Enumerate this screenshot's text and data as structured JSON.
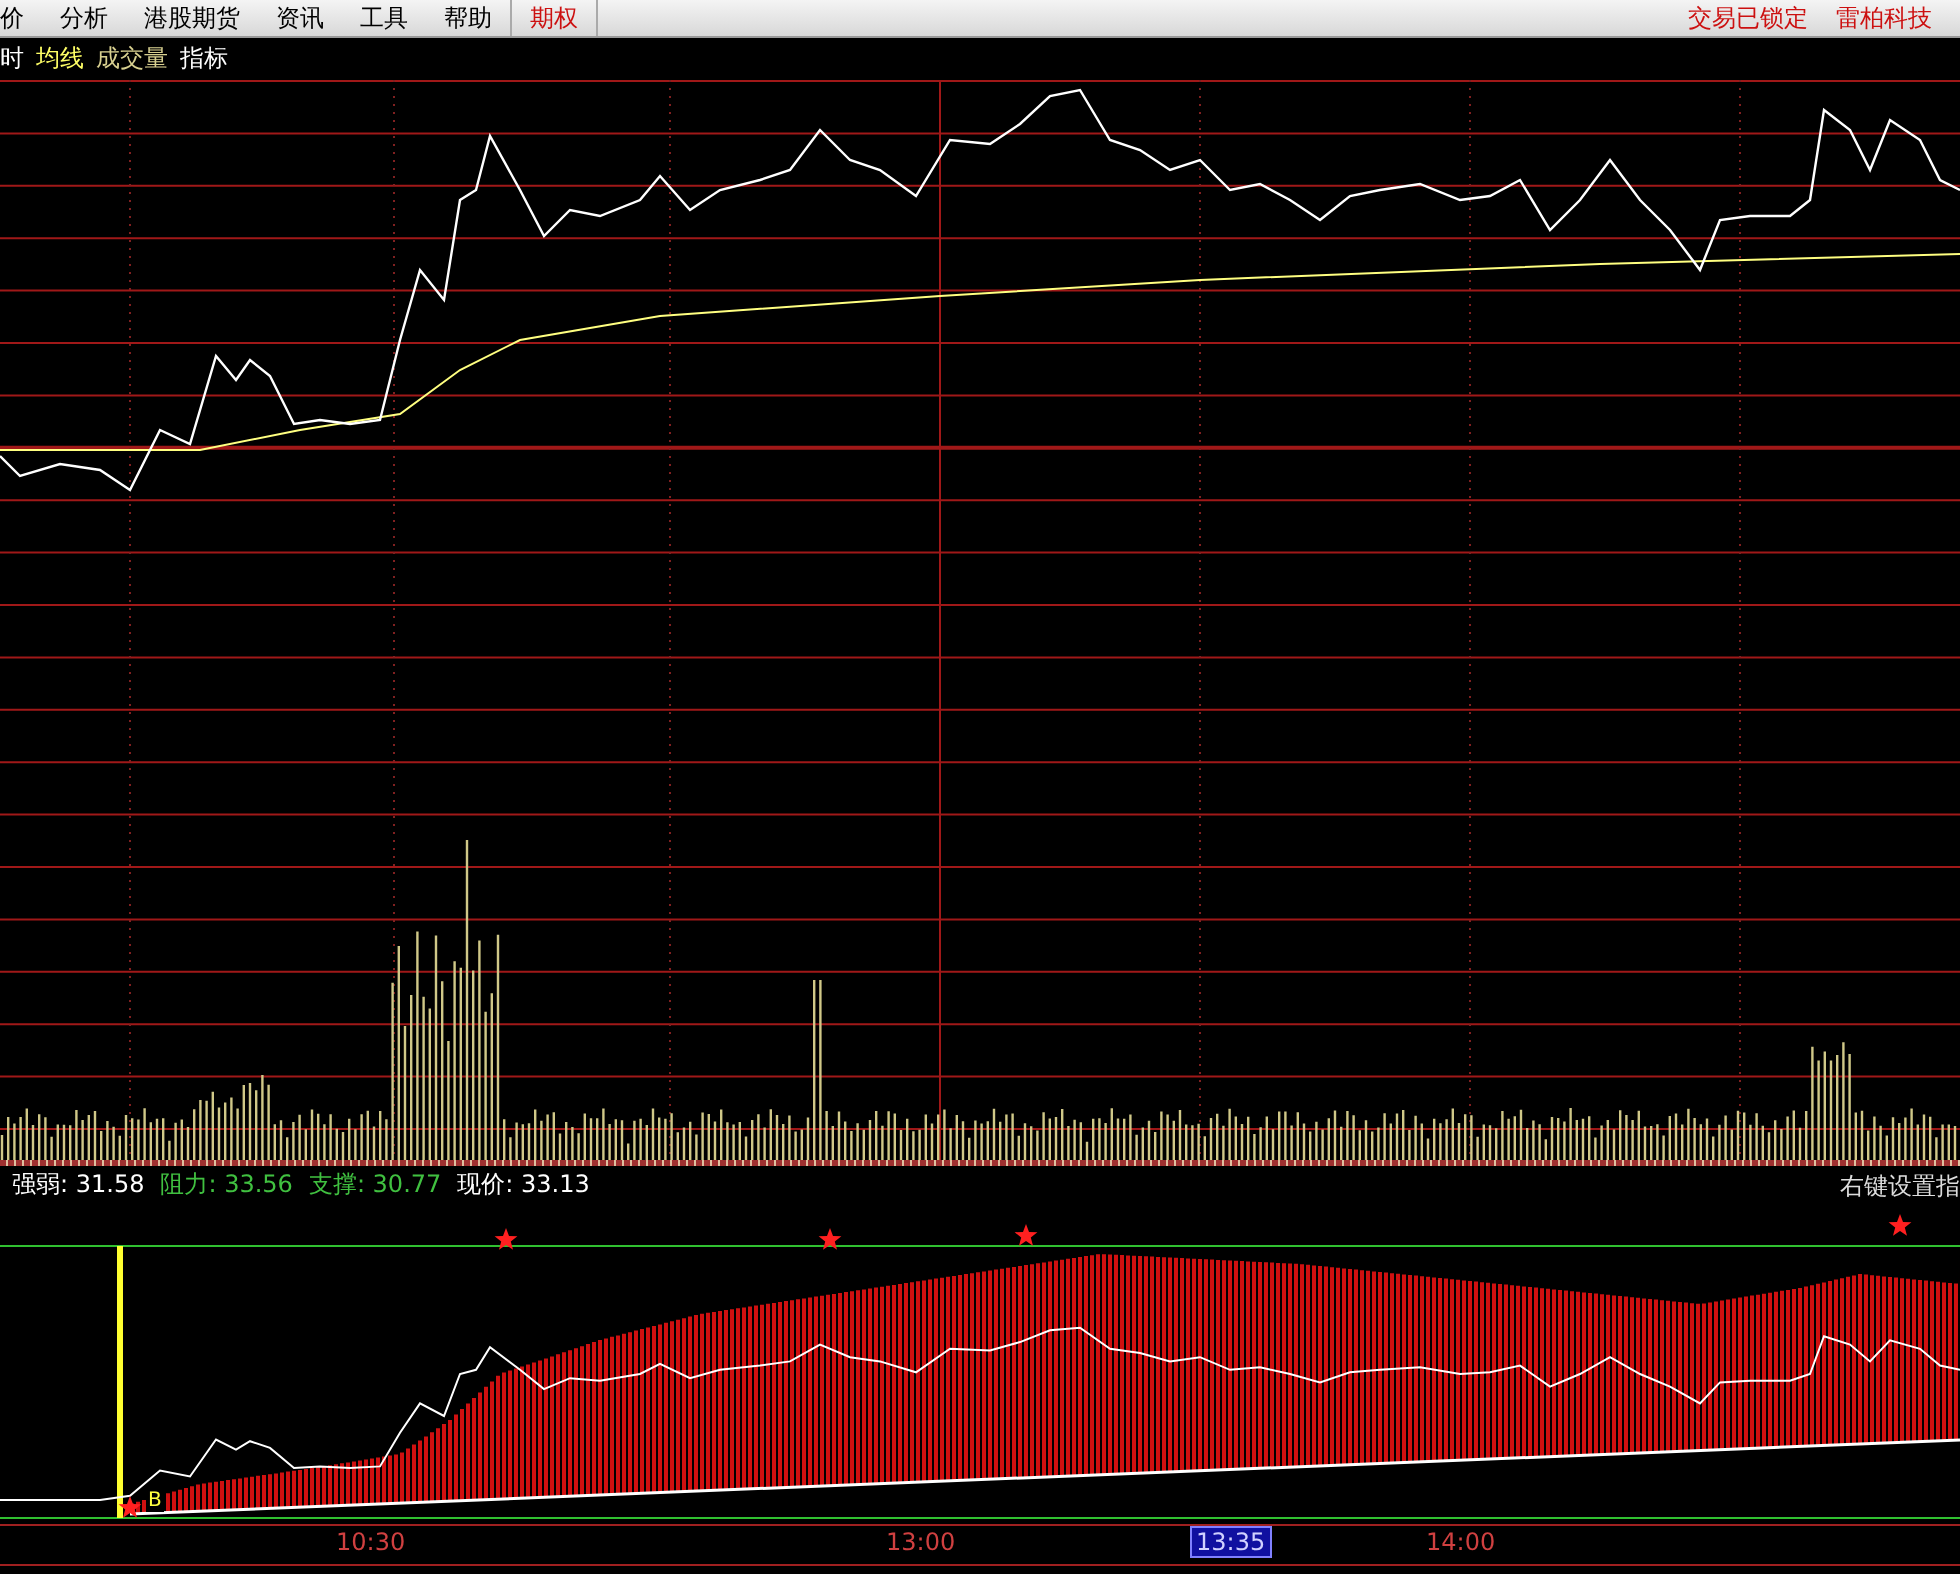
{
  "menu_bar": {
    "items": [
      {
        "label": "价",
        "color": "#000000"
      },
      {
        "label": "分析",
        "color": "#000000"
      },
      {
        "label": "港股期货",
        "color": "#000000"
      },
      {
        "label": "资讯",
        "color": "#000000"
      },
      {
        "label": "工具",
        "color": "#000000"
      },
      {
        "label": "帮助",
        "color": "#000000"
      },
      {
        "label": "期权",
        "color": "#cc1010"
      }
    ],
    "status": [
      {
        "label": "交易已锁定",
        "color": "#cc1010"
      },
      {
        "label": "雷柏科技",
        "color": "#cc1010"
      }
    ]
  },
  "legend": [
    {
      "label": "时",
      "color": "#ffffff"
    },
    {
      "label": "均线",
      "color": "#ffff66"
    },
    {
      "label": "成交量",
      "color": "#d8d090"
    },
    {
      "label": "指标",
      "color": "#ffffff"
    }
  ],
  "indicator": {
    "readouts": [
      {
        "text": "强弱: 31.58",
        "color": "#ffffff"
      },
      {
        "text": "阻力: 33.56",
        "color": "#40c040"
      },
      {
        "text": "支撑: 30.77",
        "color": "#40c040"
      },
      {
        "text": "现价: 33.13",
        "color": "#ffffff"
      }
    ],
    "hint": "右键设置指",
    "signal_marker": "B"
  },
  "time_axis": [
    {
      "label": "10:30",
      "selected": false
    },
    {
      "label": "13:00",
      "selected": false
    },
    {
      "label": "13:35",
      "selected": true
    },
    {
      "label": "14:00",
      "selected": false
    }
  ]
}
